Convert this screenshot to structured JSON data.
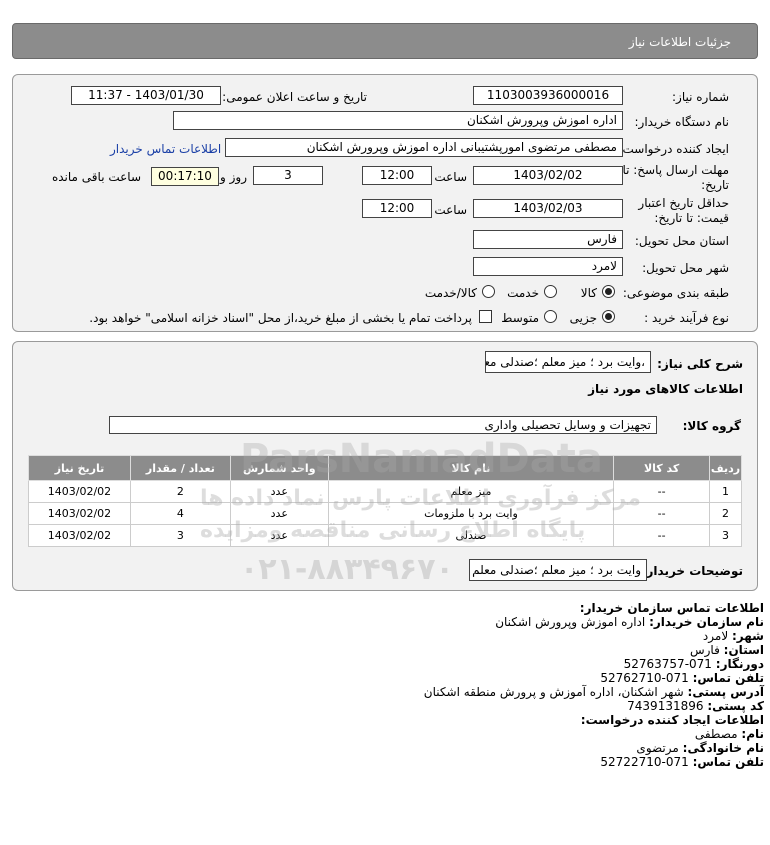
{
  "header": {
    "title": "جزئیات اطلاعات نیاز"
  },
  "form": {
    "need_number_label": "شماره نیاز:",
    "need_number": "1103003936000016",
    "announce_label": "تاریخ و ساعت اعلان عمومی:",
    "announce_value": "1403/01/30 - 11:37",
    "buyer_org_label": "نام دستگاه خریدار:",
    "buyer_org": "اداره اموزش وپرورش اشکنان",
    "creator_label": "ایجاد کننده درخواست:",
    "creator": "مصطفی مرتضوی امورپشتیبانی اداره اموزش وپرورش اشکنان",
    "buyer_contact_link": "اطلاعات تماس خریدار",
    "deadline_label_1": "مهلت ارسال پاسخ: تا",
    "deadline_label_2": "تاریخ:",
    "deadline_date": "1403/02/02",
    "time_label": "ساعت",
    "deadline_time": "12:00",
    "days_value": "3",
    "days_label": "روز و",
    "remaining_time": "00:17:10",
    "remaining_label": "ساعت باقی مانده",
    "validity_label_1": "حداقل تاریخ اعتبار",
    "validity_label_2": "قیمت: تا تاریخ:",
    "validity_date": "1403/02/03",
    "validity_time": "12:00",
    "province_label": "استان محل تحویل:",
    "province": "فارس",
    "city_label": "شهر محل تحویل:",
    "city": "لامرد",
    "category_label": "طبقه بندی موضوعی:",
    "category_options": [
      "کالا",
      "خدمت",
      "کالا/خدمت"
    ],
    "process_label": "نوع فرآیند خرید :",
    "process_options": [
      "جزیی",
      "متوسط"
    ],
    "payment_note": "پرداخت تمام یا بخشی از مبلغ خرید،از محل \"اسناد خزانه اسلامی\" خواهد بود."
  },
  "description": {
    "label": "شرح کلی نیاز:",
    "value": "،وایت برد ؛ میز معلم ؛صندلی معلم",
    "goods_info_title": "اطلاعات کالاهای مورد نیاز",
    "group_label": "گروه کالا:",
    "group_value": "تجهیزات و وسایل تحصیلی واداری"
  },
  "table": {
    "headers": [
      "ردیف",
      "کد کالا",
      "نام کالا",
      "واحد شمارش",
      "تعداد / مقدار",
      "تاریخ نیاز"
    ],
    "rows": [
      [
        "1",
        "--",
        "میز معلم",
        "عدد",
        "2",
        "1403/02/02"
      ],
      [
        "2",
        "--",
        "وایت برد با ملزومات",
        "عدد",
        "4",
        "1403/02/02"
      ],
      [
        "3",
        "--",
        "صندلی",
        "عدد",
        "3",
        "1403/02/02"
      ]
    ]
  },
  "buyer_notes": {
    "label": "توضیحات خریدار:",
    "value": "وایت برد ؛ میز معلم ؛صندلی معلم"
  },
  "contact": {
    "title": "اطلاعات تماس سازمان خریدار:",
    "org_label": "نام سازمان خریدار:",
    "org": "اداره اموزش وپرورش اشکنان",
    "city_label": "شهر:",
    "city": "لامرد",
    "province_label": "استان:",
    "province": "فارس",
    "fax_label": "دورنگار:",
    "fax": "071-52763757",
    "phone_label": "تلفن تماس:",
    "phone": "071-52762710",
    "address_label": "آدرس پستی:",
    "address": "شهر اشکنان، اداره آموزش و پرورش منطقه اشکنان",
    "postal_label": "کد پستی:",
    "postal": "7439131896",
    "creator_title": "اطلاعات ایجاد کننده درخواست:",
    "first_name_label": "نام:",
    "first_name": "مصطفی",
    "last_name_label": "نام خانوادگی:",
    "last_name": "مرتضوی",
    "creator_phone_label": "تلفن تماس:",
    "creator_phone": "071-52722710"
  },
  "watermark": {
    "brand": "ParsNamadData",
    "line1": "مرکز فرآوری اطلاعات پارس نماد داده ها",
    "line2": "پایگاه اطلاع رسانی مناقصه ومزایده",
    "phone": "۰۲۱-۸۸۳۴۹۶۷۰"
  }
}
